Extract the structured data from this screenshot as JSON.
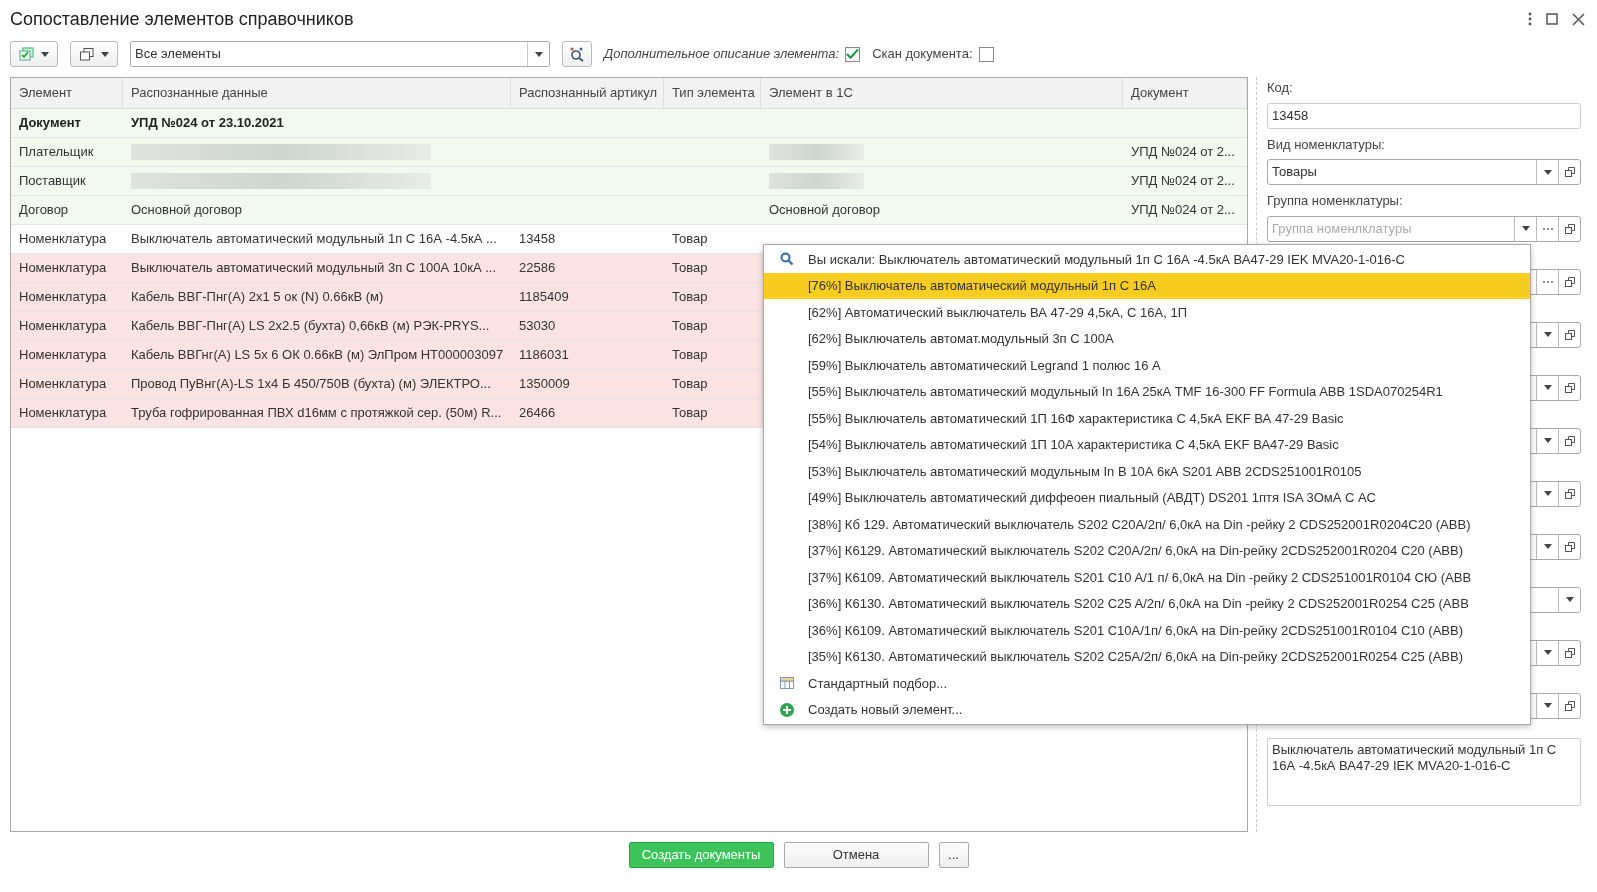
{
  "window": {
    "title": "Сопоставление элементов справочников"
  },
  "toolbar": {
    "filter_value": "Все элементы",
    "extra_description_label": "Дополнительное описание элемента:",
    "extra_description_checked": true,
    "scan_label": "Скан документа:",
    "scan_checked": false
  },
  "table": {
    "columns": [
      "Элемент",
      "Распознанные данные",
      "Распознанный артикул",
      "Тип элемента",
      "Элемент в 1С",
      "Документ"
    ],
    "rows": [
      {
        "color": "#f2faf0",
        "bold": true,
        "element": "Документ",
        "data": "УПД №024 от 23.10.2021",
        "article": "",
        "type": "",
        "element_1c": "",
        "document": ""
      },
      {
        "color": "#f2faf0",
        "bold": false,
        "element": "Плательщик",
        "data": "",
        "data_redacted": true,
        "article": "",
        "type": "",
        "element_1c": "",
        "element_1c_redacted": true,
        "document": "УПД №024 от 2..."
      },
      {
        "color": "#f2faf0",
        "bold": false,
        "element": "Поставщик",
        "data": "",
        "data_redacted": true,
        "article": "",
        "type": "",
        "element_1c": "",
        "element_1c_redacted": true,
        "document": "УПД №024 от 2..."
      },
      {
        "color": "#f2faf0",
        "bold": false,
        "element": "Договор",
        "data": "Основной договор",
        "article": "",
        "type": "",
        "element_1c": "Основной договор",
        "document": "УПД №024 от 2..."
      },
      {
        "color": "#ffffff",
        "bold": false,
        "element": "Номенклатура",
        "data": "Выключатель автоматический модульный 1п С 16А -4.5кА ...",
        "article": "13458",
        "type": "Товар",
        "element_1c": "",
        "document": ""
      },
      {
        "color": "#fbe3e3",
        "bold": false,
        "element": "Номенклатура",
        "data": "Выключатель автоматический модульный 3п С 100А 10кА ...",
        "article": "22586",
        "type": "Товар",
        "element_1c": "",
        "document": ""
      },
      {
        "color": "#fbe3e3",
        "bold": false,
        "element": "Номенклатура",
        "data": "Кабель ВВГ-Пнг(А) 2х1 5 ок (N) 0.66кВ (м)",
        "article": "1185409",
        "type": "Товар",
        "element_1c": "",
        "document": ""
      },
      {
        "color": "#fbe3e3",
        "bold": false,
        "element": "Номенклатура",
        "data": "Кабель ВВГ-Пнг(А) LS 2х2.5 (бухта) 0,66кВ (м) РЭК-PRYS...",
        "article": "53030",
        "type": "Товар",
        "element_1c": "",
        "document": ""
      },
      {
        "color": "#fbe3e3",
        "bold": false,
        "element": "Номенклатура",
        "data": "Кабель ВВГнг(А) LS 5х 6 ОК 0.66кВ (м) ЭлПром НТ000003097",
        "article": "1186031",
        "type": "Товар",
        "element_1c": "",
        "document": ""
      },
      {
        "color": "#fbe3e3",
        "bold": false,
        "element": "Номенклатура",
        "data": "Провод ПуВнг(А)-LS 1х4 Б 450/750В (бухта) (м) ЭЛЕКТРО...",
        "article": "1350009",
        "type": "Товар",
        "element_1c": "",
        "document": ""
      },
      {
        "color": "#fbe3e3",
        "bold": false,
        "element": "Номенклатура",
        "data": "Труба гофрированная ПВХ d16мм с протяжкой сер. (50м) R...",
        "article": "26466",
        "type": "Товар",
        "element_1c": "",
        "document": ""
      }
    ]
  },
  "panel": {
    "code_label": "Код:",
    "code_value": "13458",
    "kind_label": "Вид номенклатуры:",
    "kind_value": "Товары",
    "group_label": "Группа номенклатуры:",
    "group_placeholder": "Группа номенлклатуры",
    "hidden_fields": [
      {
        "kind": "ellipsis"
      },
      {
        "kind": "combo"
      },
      {
        "kind": "combo"
      },
      {
        "kind": "combo"
      },
      {
        "kind": "combo"
      },
      {
        "kind": "combo"
      },
      {
        "kind": "dropdown"
      },
      {
        "kind": "combo"
      },
      {
        "kind": "combo"
      }
    ],
    "description": "Выключатель автоматический модульный 1п С 16А -4.5кА ВА47-29 IEK MVA20-1-016-C"
  },
  "dropdown": {
    "items": [
      {
        "kind": "search",
        "text": "Вы искали: Выключатель автоматический модульный 1п С 16А -4.5кА ВА47-29 IEK MVA20-1-016-C",
        "selected": false
      },
      {
        "kind": "match",
        "text": "[76%] Выключатель автоматический модульный 1п С 16А",
        "selected": true
      },
      {
        "kind": "match",
        "text": "[62%] Автоматический выключатель ВА 47-29 4,5кА, С 16А, 1П",
        "selected": false
      },
      {
        "kind": "match",
        "text": "[62%] Выключатель автомат.модульный 3п С 100А",
        "selected": false
      },
      {
        "kind": "match",
        "text": "[59%] Выключатель автоматический Legrand 1 полюс 16 А",
        "selected": false
      },
      {
        "kind": "match",
        "text": "[55%] Выключатель автоматический модульный In 16A 25кА TMF 16-300 FF Formula ABB 1SDA070254R1",
        "selected": false
      },
      {
        "kind": "match",
        "text": "[55%] Выключатель автоматический 1П 16Ф характеристика С 4,5кА EKF ВА 47-29 Basic",
        "selected": false
      },
      {
        "kind": "match",
        "text": "[54%] Выключатель автоматический 1П 10А характеристика С 4,5кА EKF ВА47-29 Basic",
        "selected": false
      },
      {
        "kind": "match",
        "text": "[53%] Выключатель автоматический модульным In В 10А 6кА S201 ABB 2CDS251001R0105",
        "selected": false
      },
      {
        "kind": "match",
        "text": "[49%] Выключатель автоматический диффеоен пиальный (АВДТ) DS201 1птя ISA 3ОмА С АС",
        "selected": false
      },
      {
        "kind": "match",
        "text": "[38%] Кб 129. Автоматический выключатель S202 C20A/2п/ 6,0кА на Din -рейку 2 CDS252001R0204C20 (АВВ)",
        "selected": false
      },
      {
        "kind": "match",
        "text": "[37%] К6129. Автоматический выключатель S202 C20A/2п/ 6,0кА на Din-рейку 2CDS252001R0204 C20 (АВВ)",
        "selected": false
      },
      {
        "kind": "match",
        "text": "[37%] К6109. Автоматический выключатель S201 C10 A/1 п/ 6,0кА на Din -рейку 2 CDS251001R0104 СЮ (АВВ",
        "selected": false
      },
      {
        "kind": "match",
        "text": "[36%] К6130. Автоматический выключатель S202 C25 A/2п/ 6,0кА на Din -рейку 2 CDS252001R0254 C25 (АВВ",
        "selected": false
      },
      {
        "kind": "match",
        "text": "[36%] К6109. Автоматический выключатель S201 C10A/1п/ 6,0кА на Din-рейку 2CDS251001R0104 C10 (АВВ)",
        "selected": false
      },
      {
        "kind": "match",
        "text": "[35%] К6130. Автоматический выключатель S202 C25A/2п/ 6,0кА на Din-рейку 2CDS252001R0254 C25 (АВВ)",
        "selected": false
      },
      {
        "kind": "pick",
        "text": "Стандартный подбор...",
        "selected": false
      },
      {
        "kind": "create",
        "text": "Создать новый элемент...",
        "selected": false
      }
    ]
  },
  "footer": {
    "buttons": [
      {
        "kind": "primary",
        "label": "Создать документы"
      },
      {
        "kind": "default",
        "label": "Отмена"
      },
      {
        "kind": "more",
        "label": "..."
      }
    ]
  }
}
